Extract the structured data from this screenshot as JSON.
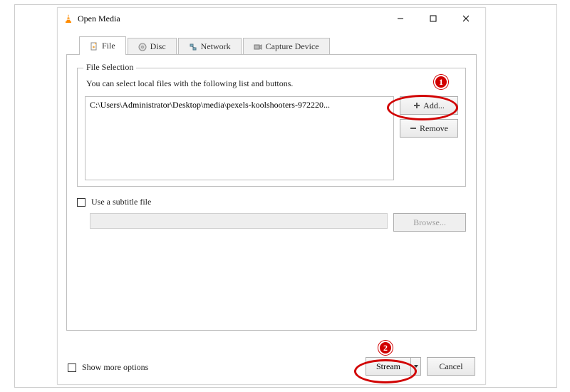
{
  "window": {
    "title": "Open Media"
  },
  "tabs": {
    "file": "File",
    "disc": "Disc",
    "network": "Network",
    "capture": "Capture Device"
  },
  "fileSelection": {
    "groupTitle": "File Selection",
    "hint": "You can select local files with the following list and buttons.",
    "items": [
      "C:\\Users\\Administrator\\Desktop\\media\\pexels-koolshooters-972220..."
    ],
    "addLabel": "Add...",
    "removeLabel": "Remove"
  },
  "subtitle": {
    "checkboxLabel": "Use a subtitle file",
    "browseLabel": "Browse..."
  },
  "footer": {
    "showMoreLabel": "Show more options",
    "streamLabel": "Stream",
    "cancelLabel": "Cancel"
  },
  "annotations": {
    "one": "1",
    "two": "2"
  }
}
